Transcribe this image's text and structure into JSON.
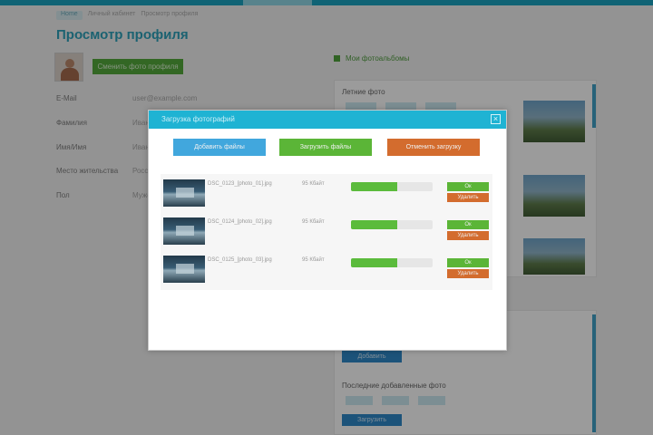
{
  "breadcrumb": [
    "Home",
    "Личный кабинет",
    "Просмотр профиля"
  ],
  "page": {
    "title": "Просмотр профиля"
  },
  "profile": {
    "change_photo_label": "Сменить фото профиля",
    "rows": [
      {
        "label": "E-Mail",
        "value": "user@example.com"
      },
      {
        "label": "Фамилия",
        "value": "Иванов"
      },
      {
        "label": "Имя/Имя",
        "value": "Иван"
      },
      {
        "label": "Место жительства",
        "value": "Россия"
      },
      {
        "label": "Пол",
        "value": "Мужской"
      }
    ]
  },
  "sidebar": {
    "section_title": "Мои фотоальбомы",
    "gallery_title": "Летние фото",
    "lower_button": "Добавить",
    "lower_title": "Последние добавленные фото",
    "lower_button2": "Загрузить"
  },
  "modal": {
    "title": "Загрузка фотографий",
    "close_symbol": "×",
    "add_label": "Добавить файлы",
    "upload_label": "Загрузить файлы",
    "cancel_label": "Отменить загрузку",
    "files": [
      {
        "name": "DSC_0123_[photo_01].jpg",
        "size": "95 Кбайт",
        "progress": 0.57,
        "ok_label": "Ок",
        "delete_label": "Удалить"
      },
      {
        "name": "DSC_0124_[photo_02].jpg",
        "size": "95 Кбайт",
        "progress": 0.57,
        "ok_label": "Ок",
        "delete_label": "Удалить"
      },
      {
        "name": "DSC_0125_[photo_03].jpg",
        "size": "95 Кбайт",
        "progress": 0.57,
        "ok_label": "Ок",
        "delete_label": "Удалить"
      }
    ]
  },
  "colors": {
    "accent": "#1fb3d3",
    "success": "#5bb537",
    "danger": "#d36c2e",
    "primary": "#41a7dd"
  }
}
